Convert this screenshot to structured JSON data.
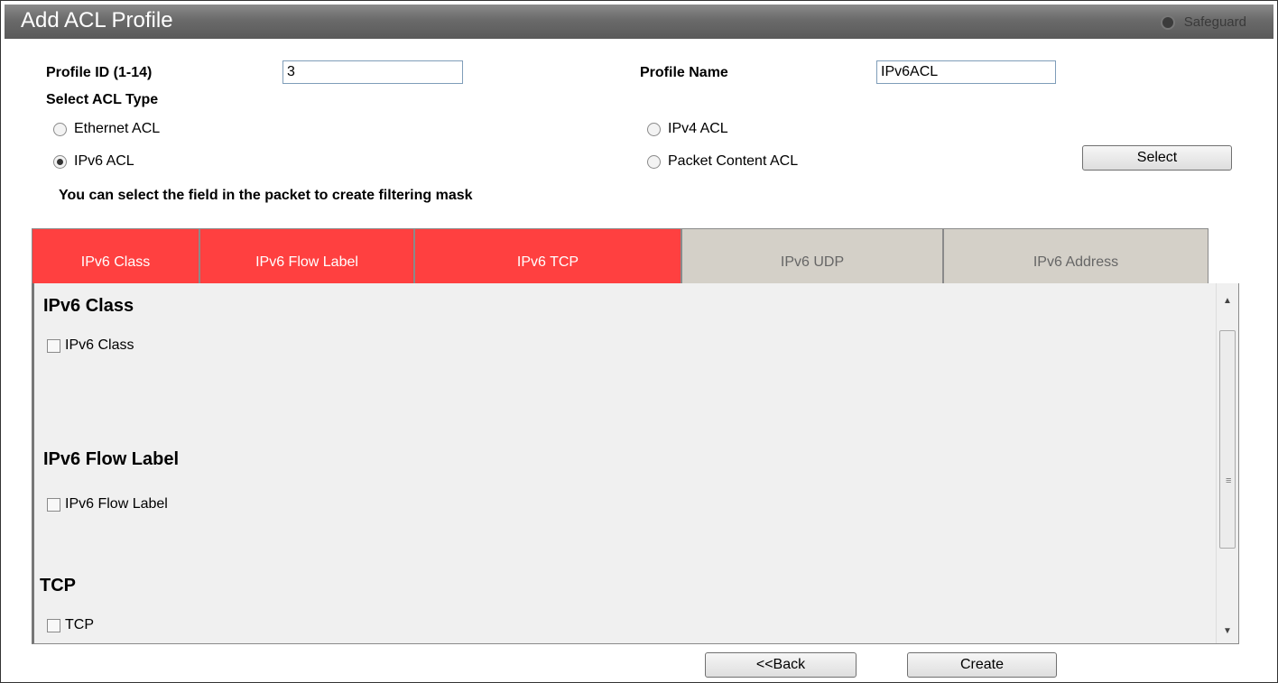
{
  "window": {
    "title": "Add ACL Profile",
    "safeguard_label": "Safeguard"
  },
  "form": {
    "profile_id_label": "Profile ID (1-14)",
    "profile_id_value": "3",
    "profile_name_label": "Profile Name",
    "profile_name_value": "IPv6ACL",
    "acl_type_label": "Select ACL Type",
    "acl_types": [
      {
        "label": "Ethernet ACL",
        "selected": false
      },
      {
        "label": "IPv4 ACL",
        "selected": false
      },
      {
        "label": "IPv6 ACL",
        "selected": true
      },
      {
        "label": "Packet Content ACL",
        "selected": false
      }
    ],
    "select_button": "Select",
    "hint": "You can select the field in the packet to create filtering mask"
  },
  "tabs": [
    {
      "label": "IPv6 Class",
      "active": true
    },
    {
      "label": "IPv6 Flow Label",
      "active": true
    },
    {
      "label": "IPv6 TCP",
      "active": true
    },
    {
      "label": "IPv6 UDP",
      "active": false
    },
    {
      "label": "IPv6 Address",
      "active": false
    }
  ],
  "sections": [
    {
      "title": "IPv6 Class",
      "checkbox": "IPv6 Class",
      "checked": false
    },
    {
      "title": "IPv6 Flow Label",
      "checkbox": "IPv6 Flow Label",
      "checked": false
    },
    {
      "title": "TCP",
      "checkbox": "TCP",
      "checked": false
    }
  ],
  "footer": {
    "back_button": "<<Back",
    "create_button": "Create"
  },
  "colors": {
    "tab_active": "#ff4040",
    "tab_inactive": "#d4d0c8",
    "titlebar": "#6a6a6a"
  }
}
